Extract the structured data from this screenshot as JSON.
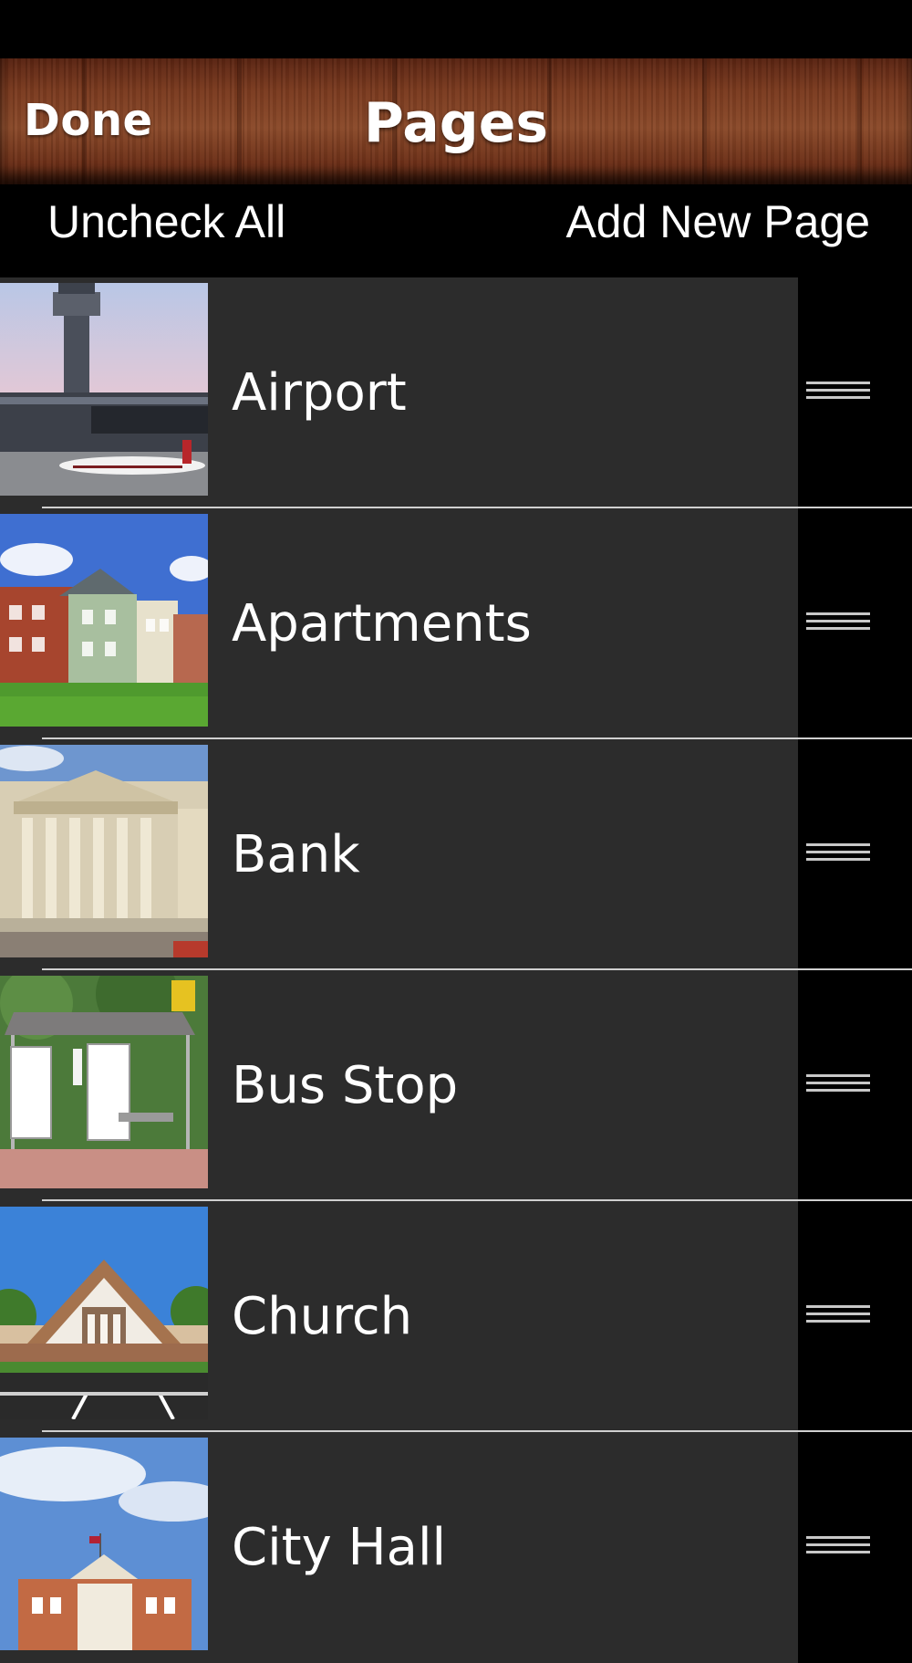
{
  "nav": {
    "done_label": "Done",
    "title": "Pages"
  },
  "toolbar": {
    "uncheck_all_label": "Uncheck All",
    "add_new_page_label": "Add New Page"
  },
  "pages": [
    {
      "label": "Airport"
    },
    {
      "label": "Apartments"
    },
    {
      "label": "Bank"
    },
    {
      "label": "Bus Stop"
    },
    {
      "label": "Church"
    },
    {
      "label": "City Hall"
    }
  ],
  "colors": {
    "row_background": "#2c2c2c",
    "handle_column": "#000000",
    "separator": "#d0d0d0",
    "wood_header": "#7a3a1f"
  }
}
